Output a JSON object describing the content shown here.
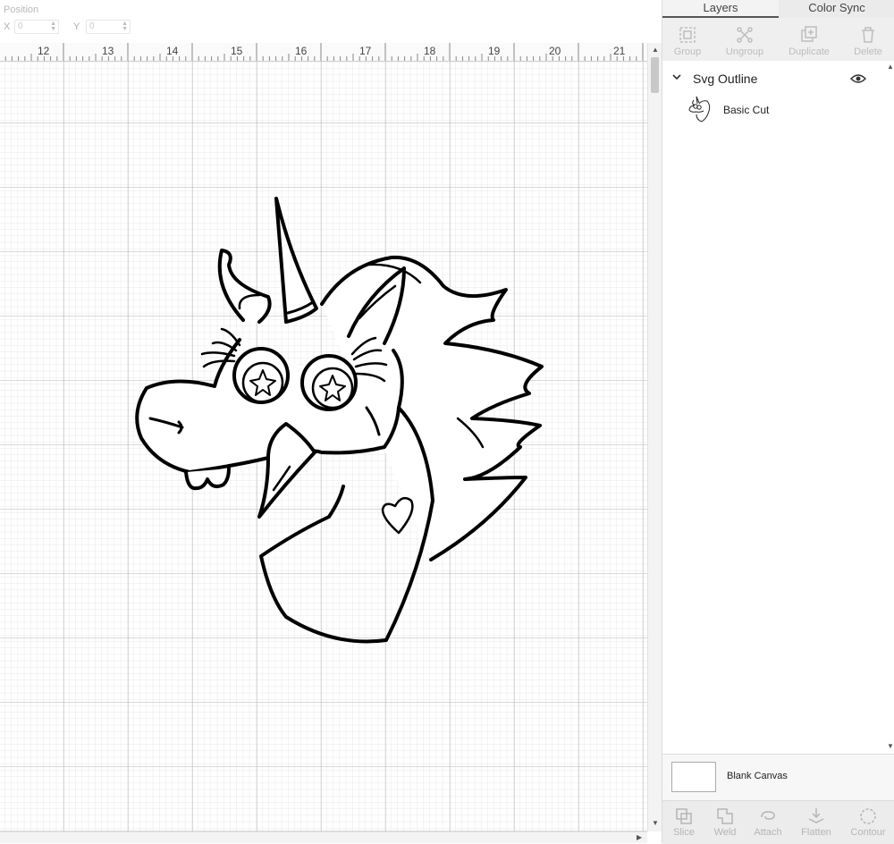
{
  "position": {
    "label": "Position",
    "x_label": "X",
    "y_label": "Y",
    "x_value": "0",
    "y_value": "0"
  },
  "ruler": {
    "numbers": [
      "12",
      "13",
      "14",
      "15",
      "16",
      "17",
      "18",
      "19",
      "20",
      "21"
    ]
  },
  "panel": {
    "tabs": [
      {
        "label": "Layers",
        "active": true
      },
      {
        "label": "Color Sync",
        "active": false
      }
    ],
    "layer_tools": [
      {
        "label": "Group",
        "icon": "group-icon"
      },
      {
        "label": "Ungroup",
        "icon": "ungroup-icon"
      },
      {
        "label": "Duplicate",
        "icon": "duplicate-icon"
      },
      {
        "label": "Delete",
        "icon": "trash-icon"
      }
    ],
    "group_name": "Svg Outline",
    "layer_name": "Basic Cut",
    "canvas_label": "Blank Canvas",
    "bottom_tools": [
      {
        "label": "Slice",
        "icon": "slice-icon"
      },
      {
        "label": "Weld",
        "icon": "weld-icon"
      },
      {
        "label": "Attach",
        "icon": "attach-icon"
      },
      {
        "label": "Flatten",
        "icon": "flatten-icon"
      },
      {
        "label": "Contour",
        "icon": "contour-icon"
      }
    ]
  },
  "colors": {
    "accent": "#333333",
    "grid_minor": "#e2e2e2",
    "grid_major": "#b5b5b5",
    "panel_bg": "#f3f3f3",
    "disabled": "#bdbdbd"
  },
  "artwork": {
    "name": "unicorn-head-outline",
    "stroke": "#000000"
  }
}
